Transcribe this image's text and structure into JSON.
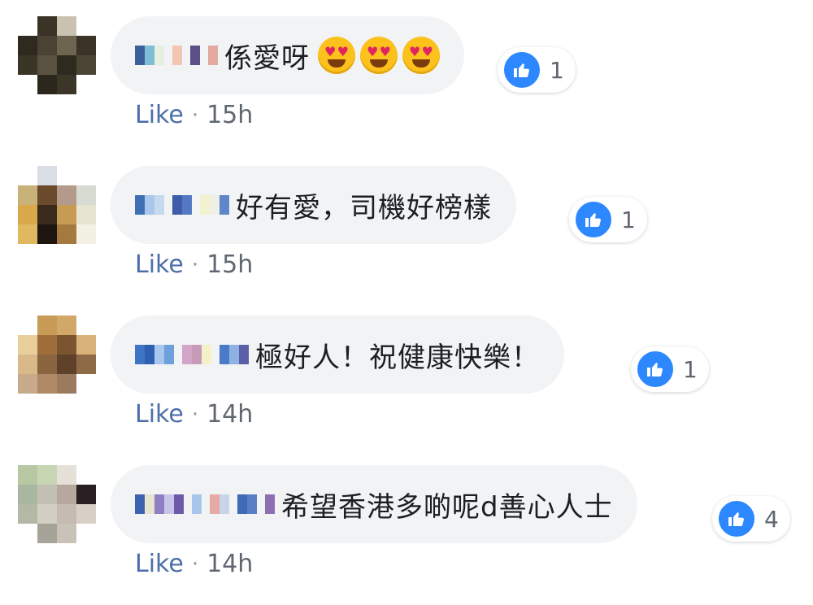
{
  "colors": {
    "bubble_bg": "#f2f3f5",
    "like_blue": "#2d88ff",
    "link_text": "#4b6fa8",
    "meta_text": "#606770"
  },
  "icons": {
    "reaction": "like-thumbs-up-icon",
    "emoji": "heart-eyes-emoji-icon"
  },
  "comments": [
    {
      "text": "係愛呀",
      "emoji_count": 3,
      "reaction_count": "1",
      "like_label": "Like",
      "separator": "·",
      "time": "15h"
    },
    {
      "text": "好有愛，司機好榜樣",
      "emoji_count": 0,
      "reaction_count": "1",
      "like_label": "Like",
      "separator": "·",
      "time": "15h"
    },
    {
      "text": "極好人！祝健康快樂！",
      "emoji_count": 0,
      "reaction_count": "1",
      "like_label": "Like",
      "separator": "·",
      "time": "14h"
    },
    {
      "text": "希望香港多啲呢d善心人士",
      "emoji_count": 0,
      "reaction_count": "4",
      "like_label": "Like",
      "separator": "·",
      "time": "14h"
    }
  ]
}
